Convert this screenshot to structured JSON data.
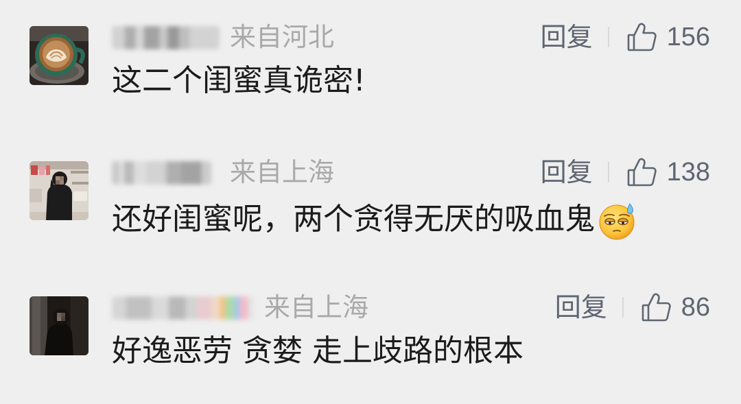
{
  "like_icon": "thumbs-up-icon",
  "colors": {
    "background": "#efefef",
    "text": "#1b1b1b",
    "meta": "#a9a9a9",
    "action": "#5f6571"
  },
  "comments": [
    {
      "location": "来自河北",
      "reply_label": "回复",
      "likes": "156",
      "text": "这二个闺蜜真诡密!"
    },
    {
      "location": "来自上海",
      "reply_label": "回复",
      "likes": "138",
      "text": "还好闺蜜呢，两个贪得无厌的吸血鬼",
      "emoji_icon": "sweat-face-icon"
    },
    {
      "location": "来自上海",
      "reply_label": "回复",
      "likes": "86",
      "text": "好逸恶劳 贪婪 走上歧路的根本"
    }
  ]
}
